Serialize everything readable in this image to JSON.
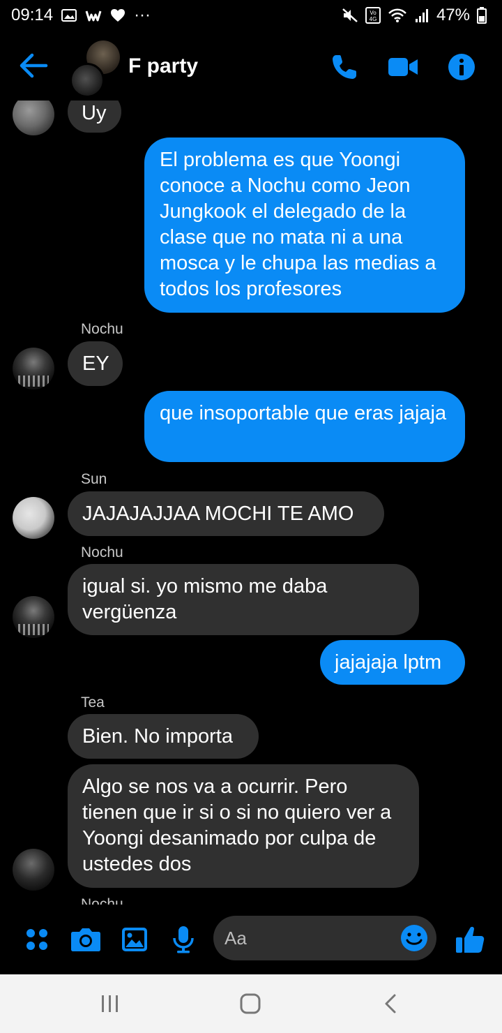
{
  "status_bar": {
    "time": "09:14",
    "battery": "47%",
    "dots": "···",
    "network": "Vo 4G"
  },
  "header": {
    "title": "F party"
  },
  "messages": [
    {
      "type": "in",
      "sender": "",
      "text": "Uy",
      "avatar": "top"
    },
    {
      "type": "out",
      "text": "El problema es que Yoongi conoce a Nochu como Jeon Jungkook el delegado de la clase que no mata ni a una mosca y le chupa las medias a todos los profesores"
    },
    {
      "type": "in",
      "sender": "Nochu",
      "text": "EY",
      "avatar": "nochu"
    },
    {
      "type": "out",
      "text": "que insoportable que eras jajaja"
    },
    {
      "type": "in",
      "sender": "Sun",
      "text": "JAJAJAJJAA MOCHI TE AMO",
      "avatar": "sun"
    },
    {
      "type": "in",
      "sender": "Nochu",
      "text": "igual si. yo mismo me daba vergüenza",
      "avatar": "nochu"
    },
    {
      "type": "out",
      "text": "jajajaja lptm"
    },
    {
      "type": "in",
      "sender": "Tea",
      "text": "Bien. No importa",
      "avatar": ""
    },
    {
      "type": "in",
      "sender": "",
      "text": "Algo se nos va a ocurrir. Pero tienen que ir si o si no quiero ver a Yoongi desanimado por culpa de ustedes dos",
      "avatar": "tea"
    },
    {
      "type": "in",
      "sender": "Nochu",
      "text": "",
      "avatar": ""
    }
  ],
  "composer": {
    "placeholder": "Aa"
  },
  "colors": {
    "accent": "#0a8bf5",
    "incoming_bubble": "#303030",
    "background": "#000000"
  },
  "icons": [
    "back-arrow-icon",
    "phone-icon",
    "video-icon",
    "info-icon",
    "apps-icon",
    "camera-icon",
    "gallery-icon",
    "mic-icon",
    "emoji-icon",
    "like-icon",
    "recents-icon",
    "home-icon",
    "nav-back-icon"
  ]
}
